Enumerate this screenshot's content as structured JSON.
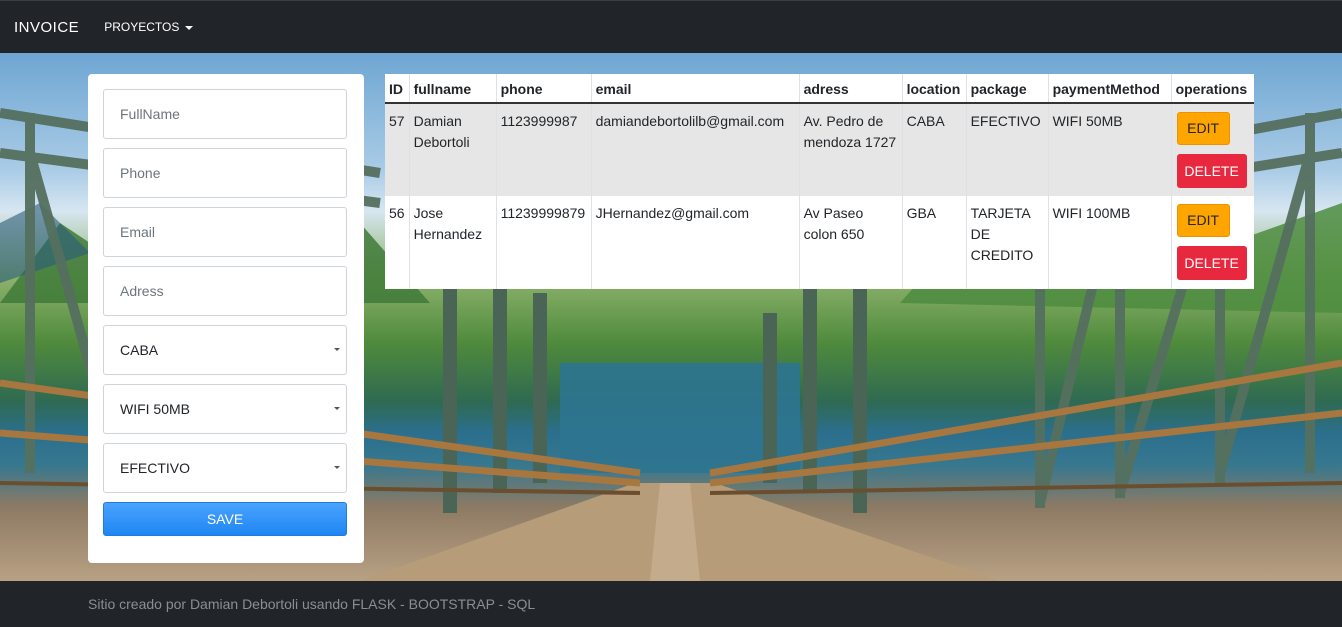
{
  "navbar": {
    "brand": "INVOICE",
    "dropdown_label": "PROYECTOS"
  },
  "form": {
    "fullname_placeholder": "FullName",
    "phone_placeholder": "Phone",
    "email_placeholder": "Email",
    "adress_placeholder": "Adress",
    "location_value": "CABA",
    "package_value": "WIFI 50MB",
    "payment_value": "EFECTIVO",
    "save_label": "SAVE"
  },
  "table": {
    "headers": [
      "ID",
      "fullname",
      "phone",
      "email",
      "adress",
      "location",
      "package",
      "paymentMethod",
      "operations"
    ],
    "rows": [
      {
        "id": "57",
        "fullname": "Damian Debortoli",
        "phone": "1123999987",
        "email": "damiandebortolilb@gmail.com",
        "adress": "Av. Pedro de mendoza 1727",
        "location": "CABA",
        "package": "EFECTIVO",
        "paymentMethod": "WIFI 50MB"
      },
      {
        "id": "56",
        "fullname": "Jose Hernandez",
        "phone": "11239999879",
        "email": "JHernandez@gmail.com",
        "adress": "Av Paseo colon 650",
        "location": "GBA",
        "package": "TARJETA DE CREDITO",
        "paymentMethod": "WIFI 100MB"
      }
    ],
    "edit_label": "EDIT",
    "delete_label": "DELETE"
  },
  "footer": {
    "text": "Sitio creado por Damian Debortoli usando FLASK - BOOTSTRAP - SQL"
  },
  "colors": {
    "navbar": "#212529",
    "save": "#1e86f2",
    "edit": "#ffa500",
    "delete": "#e8283f"
  }
}
